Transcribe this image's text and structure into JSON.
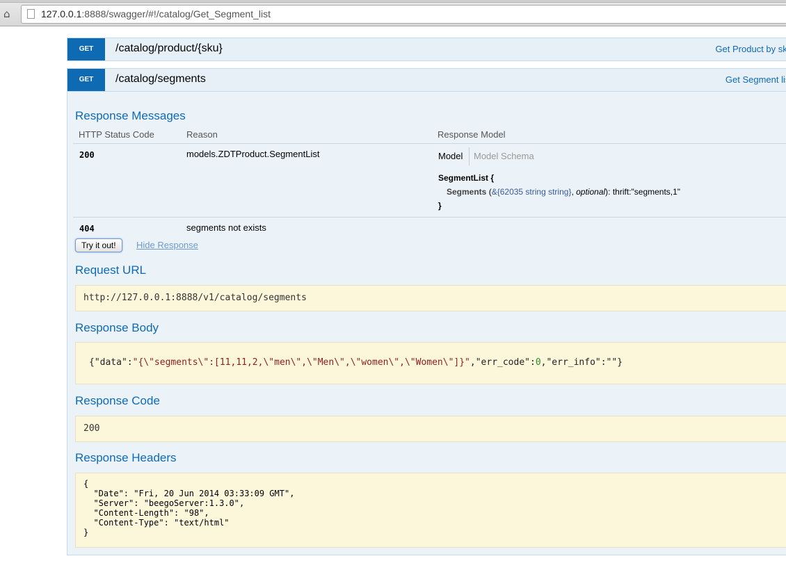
{
  "browser": {
    "url_host": "127.0.0.1",
    "url_rest": ":8888/swagger/#!/catalog/Get_Segment_list"
  },
  "endpoints": [
    {
      "method": "GET",
      "path": "/catalog/product/{sku}",
      "summary": "Get Product by sku"
    },
    {
      "method": "GET",
      "path": "/catalog/segments",
      "summary": "Get Segment list"
    }
  ],
  "responseMessages": {
    "title": "Response Messages",
    "headers": [
      "HTTP Status Code",
      "Reason",
      "Response Model"
    ],
    "rows": [
      {
        "code": "200",
        "reason": "models.ZDTProduct.SegmentList"
      },
      {
        "code": "404",
        "reason": "segments not exists"
      }
    ],
    "model_tab": "Model",
    "schema_tab": "Model Schema",
    "model_name": "SegmentList {",
    "field_name": "Segments",
    "field_type": "&{62035 string string}",
    "field_optional": "optional",
    "field_desc": ": thrift:\"segments,1\"",
    "close_brace": "}"
  },
  "actions": {
    "try": "Try it out!",
    "hide": "Hide Response"
  },
  "request": {
    "title": "Request URL",
    "url": "http://127.0.0.1:8888/v1/catalog/segments"
  },
  "responseBody": {
    "title": "Response Body",
    "parts": [
      {
        "t": "k",
        "v": "{\"data\":"
      },
      {
        "t": "s",
        "v": "\"{\\\"segments\\\":[11,11,2,\\\"men\\\",\\\"Men\\\",\\\"women\\\",\\\"Women\\\"]}\""
      },
      {
        "t": "k",
        "v": ",\"err_code\":"
      },
      {
        "t": "n",
        "v": "0"
      },
      {
        "t": "k",
        "v": ",\"err_info\":\"\"}"
      }
    ]
  },
  "responseCode": {
    "title": "Response Code",
    "value": "200"
  },
  "responseHeaders": {
    "title": "Response Headers",
    "text": "{\n  \"Date\": \"Fri, 20 Jun 2014 03:33:09 GMT\",\n  \"Server\": \"beegoServer:1.3.0\",\n  \"Content-Length\": \"98\",\n  \"Content-Type\": \"text/html\"\n}"
  }
}
